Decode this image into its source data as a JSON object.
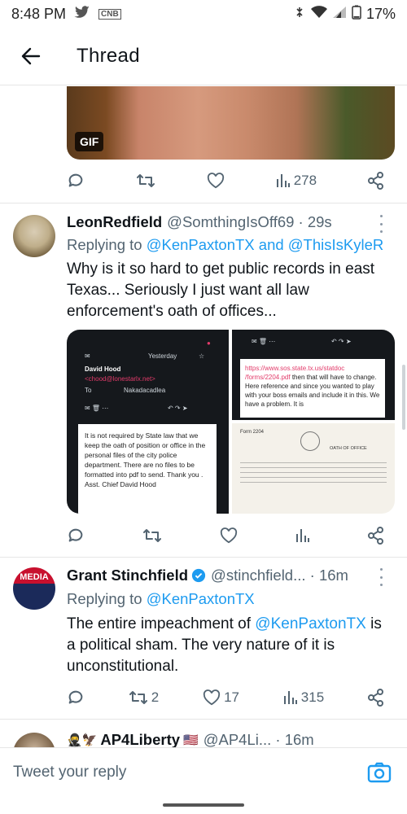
{
  "status_bar": {
    "time": "8:48 PM",
    "app_badge": "CNB",
    "battery": "17%"
  },
  "header": {
    "title": "Thread"
  },
  "prev_tweet": {
    "gif_badge": "GIF",
    "actions": {
      "reply": "",
      "retweet": "",
      "like": "",
      "views": "278"
    }
  },
  "tweets": [
    {
      "name": "LeonRedfield",
      "handle": "@SomthingIsOff69 · 29s",
      "replying_prefix": "Replying to ",
      "replying_to": "@KenPaxtonTX and @ThisIsKyleR",
      "text": "Why is it so hard to get public records in east Texas... Seriously I just want all law enforcement's  oath of offices...",
      "media": {
        "email_date": "Yesterday",
        "sender": "David Hood",
        "sender_email": "<chood@lonestarlx.net>",
        "to_label": "To",
        "to_value": "Nakadacadlea",
        "email_text": "It is not required by State law that we keep the oath of position or office in the personal files of the city police department. There are no files to be formatted into pdf to send. Thank you .",
        "signature": "Asst. Chief David Hood",
        "right_text_link": "https://www.sos.state.tx.us/statdoc /forms/2204.pdf",
        "right_text": "then that will have to change. Here reference and since you wanted to play with your boss emails and include it in this. We have a problem. It is",
        "doc_header": "Form 2204",
        "doc_title": "OATH OF OFFICE"
      },
      "actions": {
        "reply": "",
        "retweet": "",
        "like": "",
        "views": ""
      }
    },
    {
      "name": "Grant Stinchfield",
      "handle": "@stinchfield... · 16m",
      "replying_prefix": "Replying to ",
      "replying_to": "@KenPaxtonTX",
      "text_pre": "The entire impeachment of ",
      "text_link": "@KenPaxtonTX",
      "text_post": " is a political sham. The very nature of it is unconstitutional.",
      "avatar_text": "MEDIA",
      "actions": {
        "reply": "",
        "retweet": "2",
        "like": "17",
        "views": "315"
      }
    },
    {
      "name": "AP4Liberty",
      "handle": "@AP4Li... · 16m"
    }
  ],
  "composer": {
    "placeholder": "Tweet your reply"
  },
  "colors": {
    "link": "#1d9bf0",
    "muted": "#536471",
    "text": "#0f1419"
  }
}
